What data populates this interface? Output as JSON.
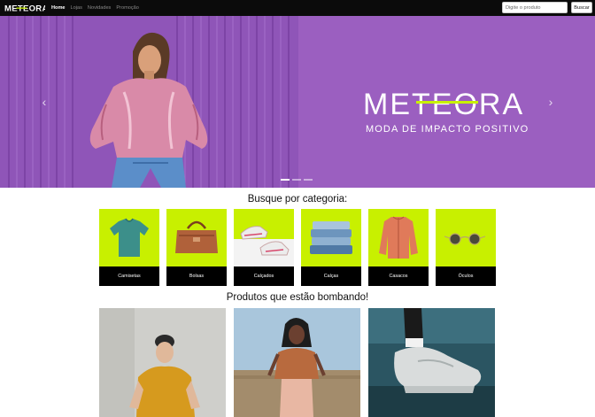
{
  "brand": {
    "name": "METEORA",
    "accent": "#c8f000"
  },
  "nav": {
    "links": [
      {
        "label": "Home",
        "active": true
      },
      {
        "label": "Lojas",
        "active": false
      },
      {
        "label": "Novidades",
        "active": false
      },
      {
        "label": "Promoção",
        "active": false
      }
    ]
  },
  "search": {
    "placeholder": "Digite o produto",
    "button_label": "Buscar"
  },
  "hero": {
    "logo_text": "METEORA",
    "tagline": "MODA DE IMPACTO POSITIVO",
    "background": "#9b5fc0",
    "slide_count": 3,
    "active_slide": 1,
    "prev_icon": "chevron-left-icon",
    "next_icon": "chevron-right-icon"
  },
  "categories": {
    "title": "Busque por categoria:",
    "items": [
      {
        "label": "Camisetas",
        "icon": "tshirt-icon"
      },
      {
        "label": "Bolsas",
        "icon": "bag-icon"
      },
      {
        "label": "Calçados",
        "icon": "shoes-icon"
      },
      {
        "label": "Calças",
        "icon": "jeans-icon"
      },
      {
        "label": "Casacos",
        "icon": "jacket-icon"
      },
      {
        "label": "Óculos",
        "icon": "sunglasses-icon"
      }
    ]
  },
  "products": {
    "title": "Produtos que estão bombando!",
    "items": [
      {
        "icon": "product-photo-tshirt"
      },
      {
        "icon": "product-photo-shirt"
      },
      {
        "icon": "product-photo-sneakers"
      }
    ]
  }
}
